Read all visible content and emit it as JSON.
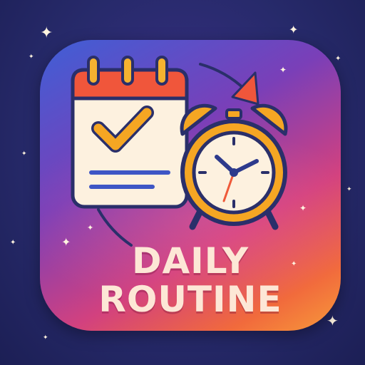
{
  "icon": {
    "title_line1": "DAILY",
    "title_line2": "ROUTINE"
  },
  "colors": {
    "calendar_top": "#f0563b",
    "calendar_rings": "#f5b230",
    "calendar_body": "#fdf1df",
    "check_mark": "#f5a623",
    "note_lines": "#3e56c5",
    "clock_frame": "#f5a623",
    "clock_face": "#fdf1df",
    "clock_hands": "#2d3a8c",
    "second_hand": "#ef5a3a",
    "arrow": "#f0563b",
    "outline": "#2a2f6a"
  },
  "icons": {
    "calendar": "calendar-check-icon",
    "clock": "alarm-clock-icon",
    "arrow": "circular-arrow-icon",
    "sparkle": "sparkle-icon"
  }
}
